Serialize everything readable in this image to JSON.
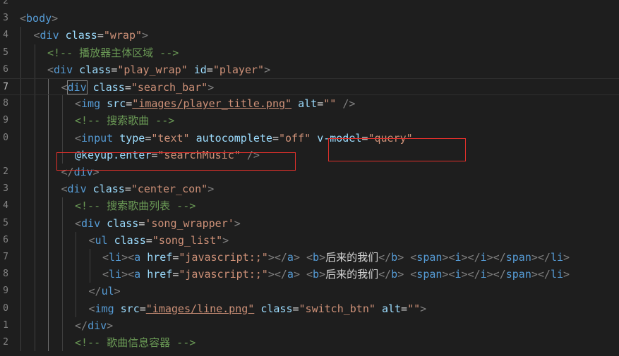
{
  "editor": {
    "line_numbers": [
      "2",
      "3",
      "4",
      "5",
      "6",
      "7",
      "8",
      "9",
      "0",
      "",
      "2",
      "3",
      "4",
      "5",
      "6",
      "7",
      "8",
      "9",
      "0",
      "1",
      "2"
    ],
    "current_line_index": 5,
    "lines": [
      {
        "indent": 0,
        "tokens": []
      },
      {
        "indent": 0,
        "tokens": [
          [
            "br",
            "<"
          ],
          [
            "tag",
            "body"
          ],
          [
            "br",
            ">"
          ]
        ]
      },
      {
        "indent": 1,
        "tokens": [
          [
            "br",
            "<"
          ],
          [
            "tag",
            "div"
          ],
          [
            "tx",
            " "
          ],
          [
            "attr",
            "class"
          ],
          [
            "eq",
            "="
          ],
          [
            "str",
            "\"wrap\""
          ],
          [
            "br",
            ">"
          ]
        ]
      },
      {
        "indent": 2,
        "tokens": [
          [
            "cm",
            "<!-- 播放器主体区域 -->"
          ]
        ]
      },
      {
        "indent": 2,
        "tokens": [
          [
            "br",
            "<"
          ],
          [
            "tag",
            "div"
          ],
          [
            "tx",
            " "
          ],
          [
            "attr",
            "class"
          ],
          [
            "eq",
            "="
          ],
          [
            "str",
            "\"play_wrap\""
          ],
          [
            "tx",
            " "
          ],
          [
            "attr",
            "id"
          ],
          [
            "eq",
            "="
          ],
          [
            "str",
            "\"player\""
          ],
          [
            "br",
            ">"
          ]
        ]
      },
      {
        "indent": 3,
        "tokens": [
          [
            "br",
            "<"
          ],
          [
            "taghl",
            "div"
          ],
          [
            "tx",
            " "
          ],
          [
            "attr",
            "class"
          ],
          [
            "eq",
            "="
          ],
          [
            "str",
            "\"search_bar\""
          ],
          [
            "brhl",
            ">"
          ]
        ]
      },
      {
        "indent": 4,
        "tokens": [
          [
            "br",
            "<"
          ],
          [
            "tag",
            "img"
          ],
          [
            "tx",
            " "
          ],
          [
            "attr",
            "src"
          ],
          [
            "eq",
            "="
          ],
          [
            "stru",
            "\"images/player_title.png\""
          ],
          [
            "tx",
            " "
          ],
          [
            "attr",
            "alt"
          ],
          [
            "eq",
            "="
          ],
          [
            "str",
            "\"\""
          ],
          [
            "tx",
            " "
          ],
          [
            "br",
            "/>"
          ]
        ]
      },
      {
        "indent": 4,
        "tokens": [
          [
            "cm",
            "<!-- 搜索歌曲 -->"
          ]
        ]
      },
      {
        "indent": 4,
        "tokens": [
          [
            "br",
            "<"
          ],
          [
            "tag",
            "input"
          ],
          [
            "tx",
            " "
          ],
          [
            "attr",
            "type"
          ],
          [
            "eq",
            "="
          ],
          [
            "str",
            "\"text\""
          ],
          [
            "tx",
            " "
          ],
          [
            "attr",
            "autocomplete"
          ],
          [
            "eq",
            "="
          ],
          [
            "str",
            "\"off\""
          ],
          [
            "tx",
            " "
          ],
          [
            "attr",
            "v-model"
          ],
          [
            "eq",
            "="
          ],
          [
            "str",
            "\"query\""
          ]
        ]
      },
      {
        "indent": 4,
        "tokens": [
          [
            "attr",
            "@keyup.enter"
          ],
          [
            "eq",
            "="
          ],
          [
            "str",
            "\"searchMusic\""
          ],
          [
            "tx",
            " "
          ],
          [
            "br",
            "/>"
          ]
        ]
      },
      {
        "indent": 3,
        "tokens": [
          [
            "br",
            "</"
          ],
          [
            "tag",
            "div"
          ],
          [
            "br",
            ">"
          ]
        ]
      },
      {
        "indent": 3,
        "tokens": [
          [
            "br",
            "<"
          ],
          [
            "tag",
            "div"
          ],
          [
            "tx",
            " "
          ],
          [
            "attr",
            "class"
          ],
          [
            "eq",
            "="
          ],
          [
            "str",
            "\"center_con\""
          ],
          [
            "br",
            ">"
          ]
        ]
      },
      {
        "indent": 4,
        "tokens": [
          [
            "cm",
            "<!-- 搜索歌曲列表 -->"
          ]
        ]
      },
      {
        "indent": 4,
        "tokens": [
          [
            "br",
            "<"
          ],
          [
            "tag",
            "div"
          ],
          [
            "tx",
            " "
          ],
          [
            "attr",
            "class"
          ],
          [
            "eq",
            "="
          ],
          [
            "str",
            "'song_wrapper'"
          ],
          [
            "br",
            ">"
          ]
        ]
      },
      {
        "indent": 5,
        "tokens": [
          [
            "br",
            "<"
          ],
          [
            "tag",
            "ul"
          ],
          [
            "tx",
            " "
          ],
          [
            "attr",
            "class"
          ],
          [
            "eq",
            "="
          ],
          [
            "str",
            "\"song_list\""
          ],
          [
            "br",
            ">"
          ]
        ]
      },
      {
        "indent": 6,
        "tokens": [
          [
            "br",
            "<"
          ],
          [
            "tag",
            "li"
          ],
          [
            "br",
            "><"
          ],
          [
            "tag",
            "a"
          ],
          [
            "tx",
            " "
          ],
          [
            "attr",
            "href"
          ],
          [
            "eq",
            "="
          ],
          [
            "str",
            "\"javascript:;\""
          ],
          [
            "br",
            "></"
          ],
          [
            "tag",
            "a"
          ],
          [
            "br",
            ">"
          ],
          [
            "tx",
            " "
          ],
          [
            "br",
            "<"
          ],
          [
            "tag",
            "b"
          ],
          [
            "br",
            ">"
          ],
          [
            "tx",
            "后来的我们"
          ],
          [
            "br",
            "</"
          ],
          [
            "tag",
            "b"
          ],
          [
            "br",
            ">"
          ],
          [
            "tx",
            " "
          ],
          [
            "br",
            "<"
          ],
          [
            "tag",
            "span"
          ],
          [
            "br",
            "><"
          ],
          [
            "tag",
            "i"
          ],
          [
            "br",
            "></"
          ],
          [
            "tag",
            "i"
          ],
          [
            "br",
            "></"
          ],
          [
            "tag",
            "span"
          ],
          [
            "br",
            "></"
          ],
          [
            "tag",
            "li"
          ],
          [
            "br",
            ">"
          ]
        ]
      },
      {
        "indent": 6,
        "tokens": [
          [
            "br",
            "<"
          ],
          [
            "tag",
            "li"
          ],
          [
            "br",
            "><"
          ],
          [
            "tag",
            "a"
          ],
          [
            "tx",
            " "
          ],
          [
            "attr",
            "href"
          ],
          [
            "eq",
            "="
          ],
          [
            "str",
            "\"javascript:;\""
          ],
          [
            "br",
            "></"
          ],
          [
            "tag",
            "a"
          ],
          [
            "br",
            ">"
          ],
          [
            "tx",
            " "
          ],
          [
            "br",
            "<"
          ],
          [
            "tag",
            "b"
          ],
          [
            "br",
            ">"
          ],
          [
            "tx",
            "后来的我们"
          ],
          [
            "br",
            "</"
          ],
          [
            "tag",
            "b"
          ],
          [
            "br",
            ">"
          ],
          [
            "tx",
            " "
          ],
          [
            "br",
            "<"
          ],
          [
            "tag",
            "span"
          ],
          [
            "br",
            "><"
          ],
          [
            "tag",
            "i"
          ],
          [
            "br",
            "></"
          ],
          [
            "tag",
            "i"
          ],
          [
            "br",
            "></"
          ],
          [
            "tag",
            "span"
          ],
          [
            "br",
            "></"
          ],
          [
            "tag",
            "li"
          ],
          [
            "br",
            ">"
          ]
        ]
      },
      {
        "indent": 5,
        "tokens": [
          [
            "br",
            "</"
          ],
          [
            "tag",
            "ul"
          ],
          [
            "br",
            ">"
          ]
        ]
      },
      {
        "indent": 5,
        "tokens": [
          [
            "br",
            "<"
          ],
          [
            "tag",
            "img"
          ],
          [
            "tx",
            " "
          ],
          [
            "attr",
            "src"
          ],
          [
            "eq",
            "="
          ],
          [
            "stru",
            "\"images/line.png\""
          ],
          [
            "tx",
            " "
          ],
          [
            "attr",
            "class"
          ],
          [
            "eq",
            "="
          ],
          [
            "str",
            "\"switch_btn\""
          ],
          [
            "tx",
            " "
          ],
          [
            "attr",
            "alt"
          ],
          [
            "eq",
            "="
          ],
          [
            "str",
            "\"\""
          ],
          [
            "br",
            ">"
          ]
        ]
      },
      {
        "indent": 4,
        "tokens": [
          [
            "br",
            "</"
          ],
          [
            "tag",
            "div"
          ],
          [
            "br",
            ">"
          ]
        ]
      },
      {
        "indent": 4,
        "tokens": [
          [
            "cm",
            "<!-- 歌曲信息容器 -->"
          ]
        ]
      }
    ]
  },
  "annotations": {
    "box_color": "#e0302b",
    "boxes": [
      "v-model-annotation",
      "keyup-enter-annotation"
    ]
  }
}
